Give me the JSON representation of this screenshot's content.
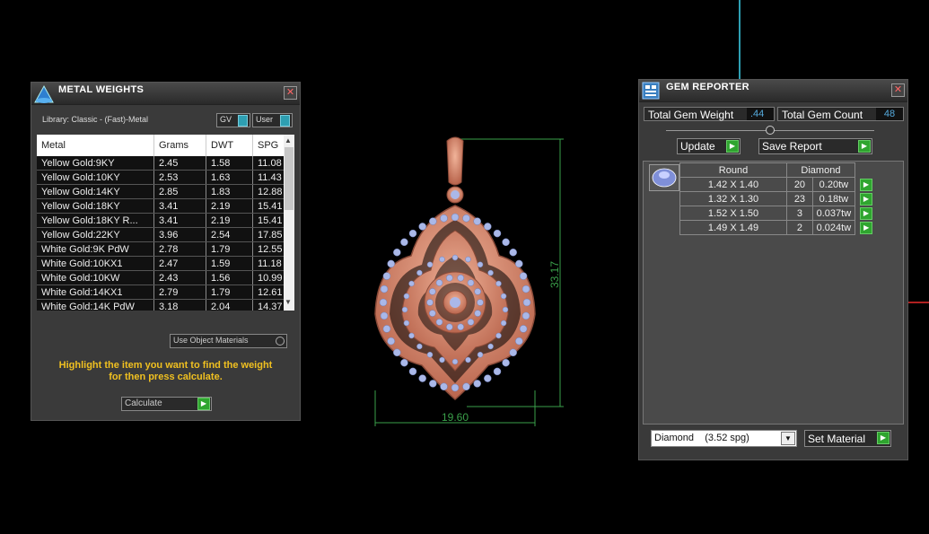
{
  "metal_weights": {
    "title": "METAL WEIGHTS",
    "library": "Library: Classic - (Fast)-Metal",
    "gv_label": "GV",
    "user_label": "User",
    "columns": [
      "Metal",
      "Grams",
      "DWT",
      "SPG"
    ],
    "rows": [
      [
        "Yellow Gold:9KY",
        "2.45",
        "1.58",
        "11.08"
      ],
      [
        "Yellow Gold:10KY",
        "2.53",
        "1.63",
        "11.43"
      ],
      [
        "Yellow Gold:14KY",
        "2.85",
        "1.83",
        "12.88"
      ],
      [
        "Yellow Gold:18KY",
        "3.41",
        "2.19",
        "15.41"
      ],
      [
        "Yellow Gold:18KY R...",
        "3.41",
        "2.19",
        "15.41"
      ],
      [
        "Yellow Gold:22KY",
        "3.96",
        "2.54",
        "17.85"
      ],
      [
        "White Gold:9K PdW",
        "2.78",
        "1.79",
        "12.55"
      ],
      [
        "White Gold:10KX1",
        "2.47",
        "1.59",
        "11.18"
      ],
      [
        "White Gold:10KW",
        "2.43",
        "1.56",
        "10.99"
      ],
      [
        "White Gold:14KX1",
        "2.79",
        "1.79",
        "12.61"
      ],
      [
        "White Gold:14K PdW",
        "3.18",
        "2.04",
        "14.37"
      ]
    ],
    "use_object_materials": "Use Object Materials",
    "instruction_line1": "Highlight the item you want to find the weight",
    "instruction_line2": "for then press calculate.",
    "calculate_label": "Calculate"
  },
  "pendant": {
    "height_dim": "33.17",
    "width_dim": "19.60"
  },
  "gem_reporter": {
    "title": "GEM REPORTER",
    "total_weight_label": "Total Gem Weight",
    "total_weight_value": ".44",
    "total_count_label": "Total Gem Count",
    "total_count_value": "48",
    "update_label": "Update",
    "save_report_label": "Save Report",
    "shape_header": "Round",
    "material_header": "Diamond",
    "rows": [
      [
        "1.42 X 1.40",
        "20",
        "0.20tw"
      ],
      [
        "1.32 X 1.30",
        "23",
        "0.18tw"
      ],
      [
        "1.52 X 1.50",
        "3",
        "0.037tw"
      ],
      [
        "1.49 X 1.49",
        "2",
        "0.024tw"
      ]
    ],
    "material_select": "Diamond    (3.52 spg)",
    "set_material_label": "Set Material"
  },
  "colors": {
    "rose_gold": "#d98a6e",
    "gem_blue": "#aab8e8",
    "dimension_green": "#3aa04a",
    "instruction_yellow": "#f0c020",
    "accent_teal": "#2e9fb2",
    "button_green": "#2fa52f"
  }
}
